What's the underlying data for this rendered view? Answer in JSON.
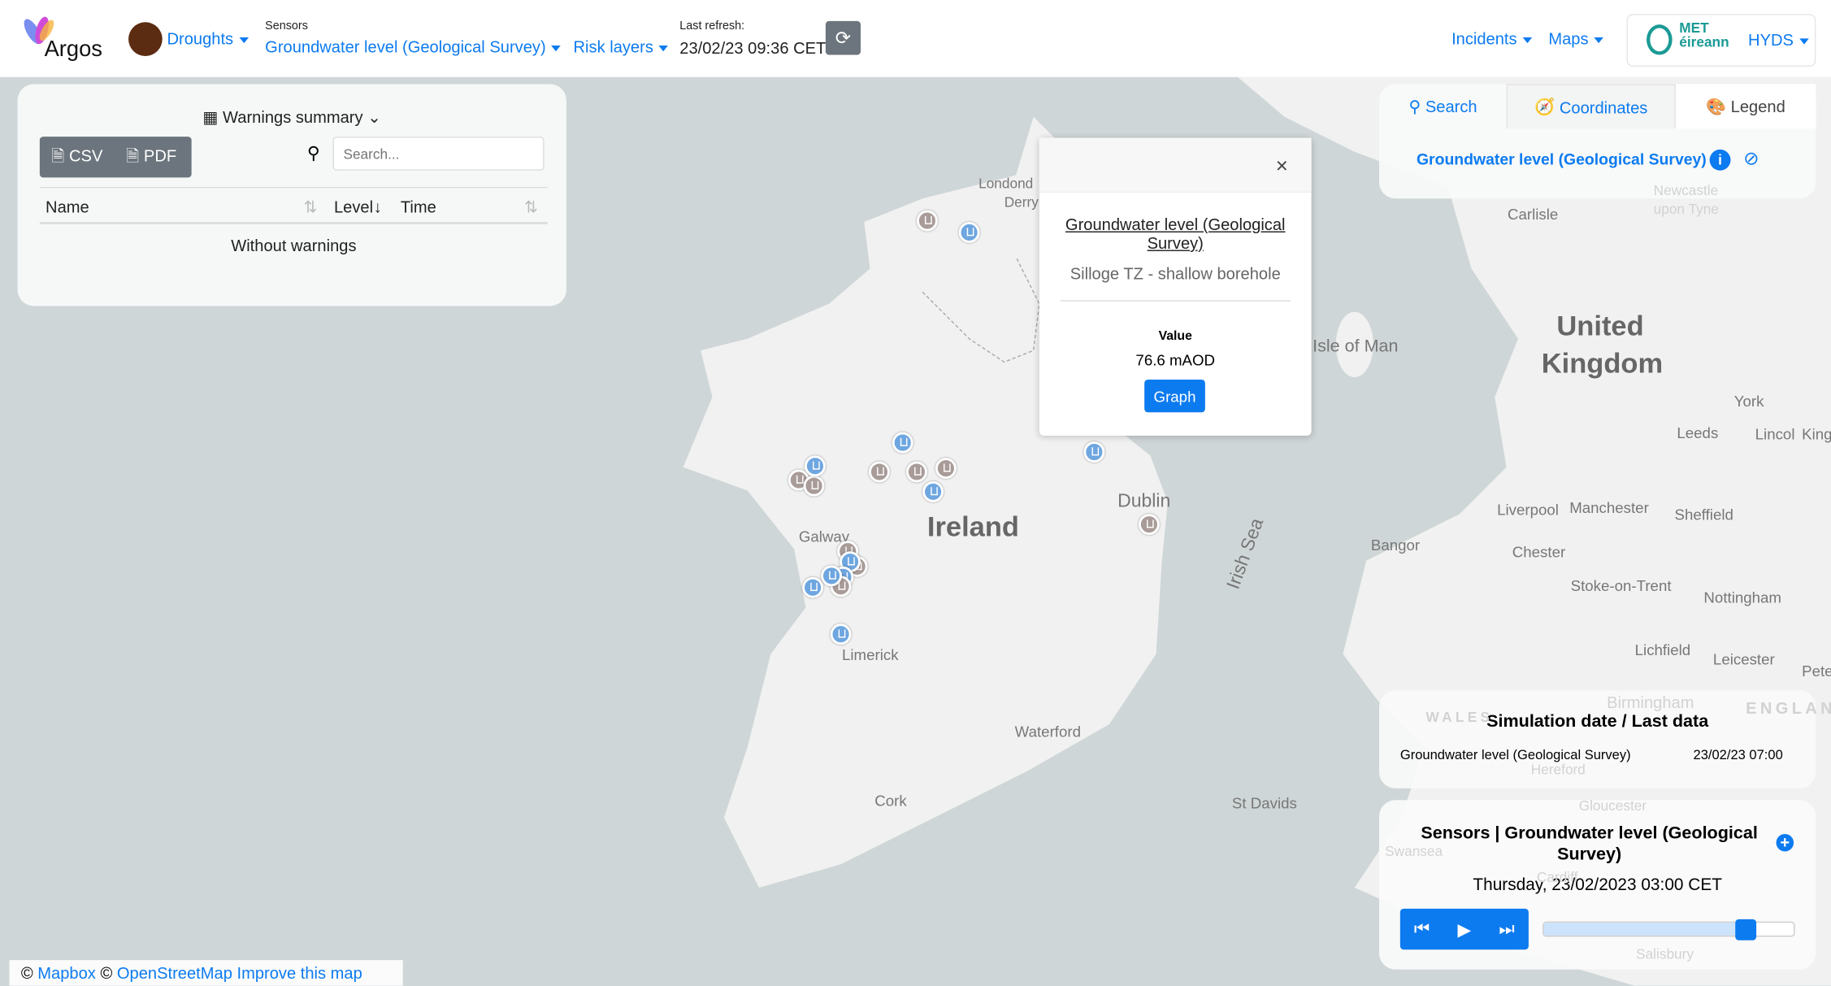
{
  "header": {
    "app_name": "Argos",
    "hazard": "Droughts",
    "sensors_label": "Sensors",
    "sensor_selected": "Groundwater level (Geological Survey)",
    "risk_layers": "Risk layers",
    "last_refresh_label": "Last refresh:",
    "last_refresh": "23/02/23 09:36 CET",
    "incidents": "Incidents",
    "maps": "Maps",
    "org_logo_text": "MET éireann",
    "org": "HYDS"
  },
  "warnings": {
    "title": "Warnings summary",
    "csv": "CSV",
    "pdf": "PDF",
    "search_placeholder": "Search...",
    "columns": [
      "Name",
      "Level",
      "Time"
    ],
    "empty": "Without warnings"
  },
  "popup": {
    "title": "Groundwater level (Geological Survey)",
    "station": "Silloge TZ - shallow borehole",
    "value_label": "Value",
    "value": "76.6 mAOD",
    "graph": "Graph"
  },
  "right_panel": {
    "tabs": [
      "Search",
      "Coordinates",
      "Legend"
    ],
    "active_tab": "Legend",
    "layer": "Groundwater level (Geological Survey)"
  },
  "simulation": {
    "title": "Simulation date / Last data",
    "rows": [
      {
        "name": "Groundwater level (Geological Survey)",
        "date": "23/02/23 07:00"
      }
    ]
  },
  "timeline": {
    "title": "Sensors | Groundwater level (Geological Survey)",
    "datetime": "Thursday, 23/02/2023 03:00 CET",
    "progress": 0.81
  },
  "attribution": {
    "copy": "©",
    "mapbox": "Mapbox",
    "osm": "OpenStreetMap",
    "improve": "Improve this map"
  },
  "map_labels": {
    "ireland": "Ireland",
    "uk1": "United",
    "uk2": "Kingdom",
    "dublin": "Dublin",
    "galway": "Galway",
    "limerick": "Limerick",
    "cork": "Cork",
    "waterford": "Waterford",
    "derry1": "Londond",
    "derry2": "Derry",
    "irish_sea": "Irish Sea",
    "isle_of_man": "Isle of Man",
    "carlisle": "Carlisle",
    "newcastle": "Newcastle upon Tyne",
    "york": "York",
    "leeds": "Leeds",
    "liverpool": "Liverpool",
    "manchester": "Manchester",
    "sheffield": "Sheffield",
    "bangor": "Bangor",
    "chester": "Chester",
    "stoke": "Stoke-on-Trent",
    "nottingham": "Nottingham",
    "lichfield": "Lichfield",
    "leicester": "Leicester",
    "birmingham": "Birmingham",
    "st_davids": "St Davids",
    "wales": "WALES",
    "england": "ENGLAN",
    "hereford": "Hereford",
    "gloucester": "Gloucester",
    "swansea": "Swansea",
    "cardiff": "Cardiff",
    "salisbury": "Salisbury",
    "lincoln": "Lincol",
    "kingston": "King",
    "pete": "Pete"
  },
  "colors": {
    "accent": "#0d7bf0",
    "sea": "#cfd6d7",
    "land": "#f1f1f1",
    "marker_blue": "#6ea6e0",
    "marker_brown": "#a89b98"
  }
}
